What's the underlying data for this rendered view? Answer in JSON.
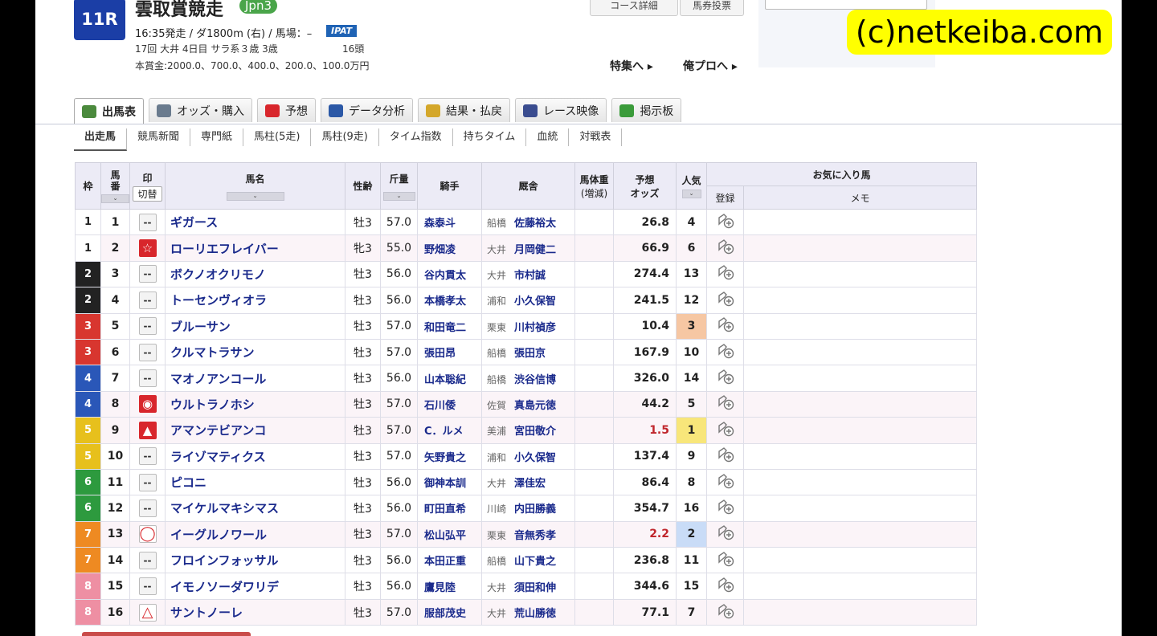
{
  "race": {
    "number": "11R",
    "name": "雲取賞競走",
    "grade": "Jpn3",
    "info1": "16:35発走 / ダ1800m (右) / 馬場：–",
    "ipat": "IPAT",
    "info2": "17回 大井 4日目 サラ系３歳 3歳",
    "count": "16頭",
    "prize": "本賞金:2000.0、700.0、400.0、200.0、100.0万円"
  },
  "links": {
    "course": "コース詳細",
    "vote": "馬券投票",
    "special": "特集へ ▸",
    "pro": "俺プロへ ▸"
  },
  "watermark": "(c)netkeiba.com",
  "tabs": [
    {
      "label": "出馬表",
      "icon_color": "#4b8a3d"
    },
    {
      "label": "オッズ・購入",
      "icon_color": "#6a7b8e"
    },
    {
      "label": "予想",
      "icon_color": "#d8262c"
    },
    {
      "label": "データ分析",
      "icon_color": "#2b58a6"
    },
    {
      "label": "結果・払戻",
      "icon_color": "#d4a72a"
    },
    {
      "label": "レース映像",
      "icon_color": "#3a4c8f"
    },
    {
      "label": "掲示板",
      "icon_color": "#3a9b3a"
    }
  ],
  "subtabs": [
    "出走馬",
    "競馬新聞",
    "専門紙",
    "馬柱(5走)",
    "馬柱(9走)",
    "タイム指数",
    "持ちタイム",
    "血統",
    "対戦表"
  ],
  "headers": {
    "waku": "枠",
    "uma": "馬番",
    "mark": "印",
    "toggle": "切替",
    "name": "馬名",
    "sex": "性齢",
    "weight": "斤量",
    "jockey": "騎手",
    "trainer": "厩舎",
    "body": "馬体重",
    "body2": "(増減)",
    "odds": "予想",
    "odds2": "オッズ",
    "pop": "人気",
    "fav": "お気に入り馬",
    "reg": "登録",
    "memo": "メモ"
  },
  "rows": [
    {
      "waku": "1",
      "uma": "1",
      "mark": "--",
      "name": "ギガース",
      "sex": "牡3",
      "wt": "57.0",
      "jockey": "森泰斗",
      "region": "船橋",
      "trainer": "佐藤裕太",
      "odds": "26.8",
      "pop": "4"
    },
    {
      "waku": "1",
      "uma": "2",
      "mark": "☆",
      "name": "ローリエフレイバー",
      "sex": "牝3",
      "wt": "55.0",
      "jockey": "野畑凌",
      "region": "大井",
      "trainer": "月岡健二",
      "odds": "66.9",
      "pop": "6"
    },
    {
      "waku": "2",
      "uma": "3",
      "mark": "--",
      "name": "ボクノオクリモノ",
      "sex": "牡3",
      "wt": "56.0",
      "jockey": "谷内貫太",
      "region": "大井",
      "trainer": "市村誠",
      "odds": "274.4",
      "pop": "13"
    },
    {
      "waku": "2",
      "uma": "4",
      "mark": "--",
      "name": "トーセンヴィオラ",
      "sex": "牡3",
      "wt": "56.0",
      "jockey": "本橋孝太",
      "region": "浦和",
      "trainer": "小久保智",
      "odds": "241.5",
      "pop": "12"
    },
    {
      "waku": "3",
      "uma": "5",
      "mark": "--",
      "name": "ブルーサン",
      "sex": "牡3",
      "wt": "57.0",
      "jockey": "和田竜二",
      "region": "栗東",
      "trainer": "川村禎彦",
      "odds": "10.4",
      "pop": "3"
    },
    {
      "waku": "3",
      "uma": "6",
      "mark": "--",
      "name": "クルマトラサン",
      "sex": "牡3",
      "wt": "57.0",
      "jockey": "張田昂",
      "region": "船橋",
      "trainer": "張田京",
      "odds": "167.9",
      "pop": "10"
    },
    {
      "waku": "4",
      "uma": "7",
      "mark": "--",
      "name": "マオノアンコール",
      "sex": "牡3",
      "wt": "56.0",
      "jockey": "山本聡紀",
      "region": "船橋",
      "trainer": "渋谷信博",
      "odds": "326.0",
      "pop": "14"
    },
    {
      "waku": "4",
      "uma": "8",
      "mark": "◉",
      "name": "ウルトラノホシ",
      "sex": "牡3",
      "wt": "57.0",
      "jockey": "石川倭",
      "region": "佐賀",
      "trainer": "真島元徳",
      "odds": "44.2",
      "pop": "5"
    },
    {
      "waku": "5",
      "uma": "9",
      "mark": "▲",
      "name": "アマンテビアンコ",
      "sex": "牡3",
      "wt": "57.0",
      "jockey": "C．ルメ",
      "region": "美浦",
      "trainer": "宮田敬介",
      "odds": "1.5",
      "pop": "1"
    },
    {
      "waku": "5",
      "uma": "10",
      "mark": "--",
      "name": "ライゾマティクス",
      "sex": "牡3",
      "wt": "57.0",
      "jockey": "矢野貴之",
      "region": "浦和",
      "trainer": "小久保智",
      "odds": "137.4",
      "pop": "9"
    },
    {
      "waku": "6",
      "uma": "11",
      "mark": "--",
      "name": "ピコニ",
      "sex": "牡3",
      "wt": "56.0",
      "jockey": "御神本訓",
      "region": "大井",
      "trainer": "澤佳宏",
      "odds": "86.4",
      "pop": "8"
    },
    {
      "waku": "6",
      "uma": "12",
      "mark": "--",
      "name": "マイケルマキシマス",
      "sex": "牡3",
      "wt": "56.0",
      "jockey": "町田直希",
      "region": "川崎",
      "trainer": "内田勝義",
      "odds": "354.7",
      "pop": "16"
    },
    {
      "waku": "7",
      "uma": "13",
      "mark": "◯",
      "name": "イーグルノワール",
      "sex": "牡3",
      "wt": "57.0",
      "jockey": "松山弘平",
      "region": "栗東",
      "trainer": "音無秀孝",
      "odds": "2.2",
      "pop": "2"
    },
    {
      "waku": "7",
      "uma": "14",
      "mark": "--",
      "name": "フロインフォッサル",
      "sex": "牡3",
      "wt": "56.0",
      "jockey": "本田正重",
      "region": "船橋",
      "trainer": "山下貴之",
      "odds": "236.8",
      "pop": "11"
    },
    {
      "waku": "8",
      "uma": "15",
      "mark": "--",
      "name": "イモノソーダワリデ",
      "sex": "牡3",
      "wt": "56.0",
      "jockey": "鷹見陸",
      "region": "大井",
      "trainer": "須田和伸",
      "odds": "344.6",
      "pop": "15"
    },
    {
      "waku": "8",
      "uma": "16",
      "mark": "△",
      "name": "サントノーレ",
      "sex": "牡3",
      "wt": "57.0",
      "jockey": "服部茂史",
      "region": "大井",
      "trainer": "荒山勝徳",
      "odds": "77.1",
      "pop": "7"
    }
  ],
  "waku_colors": {
    "1": "#ffffff",
    "2": "#222222",
    "3": "#d8362f",
    "4": "#2a57b8",
    "5": "#e7c01c",
    "6": "#2d9a3e",
    "7": "#ee8a22",
    "8": "#ee8fa3"
  },
  "pop_colors": {
    "1": "#f8e67a",
    "2": "#c9dcf7",
    "3": "#f6c7a3"
  }
}
